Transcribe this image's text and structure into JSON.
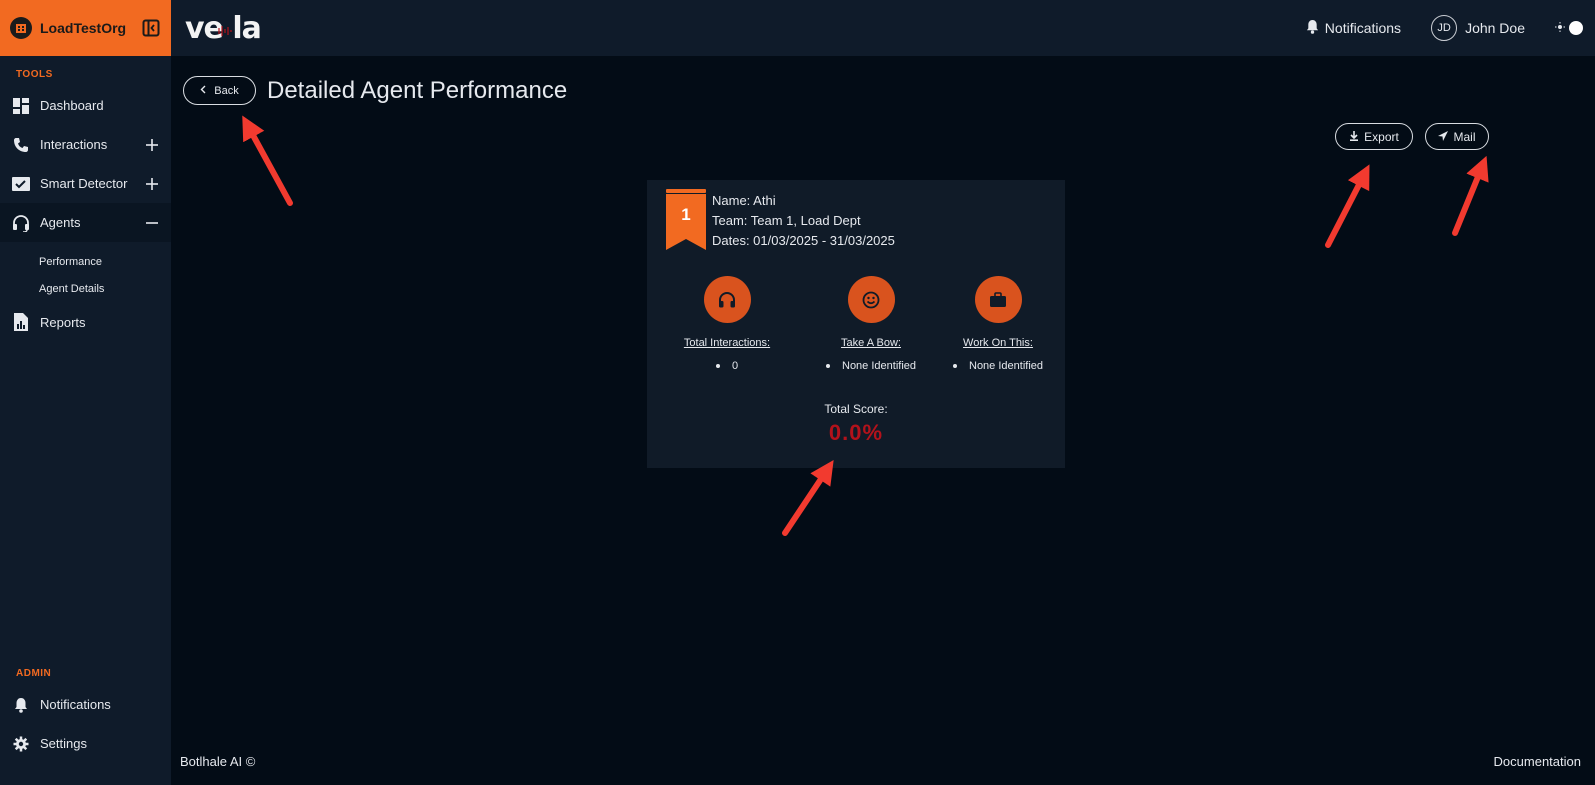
{
  "org": {
    "name": "LoadTestOrg"
  },
  "sidebar": {
    "tools_label": "TOOLS",
    "items": [
      {
        "label": "Dashboard",
        "icon": "dashboard-icon"
      },
      {
        "label": "Interactions",
        "icon": "phone-icon",
        "toggle": "+"
      },
      {
        "label": "Smart Detector",
        "icon": "detector-icon",
        "toggle": "+"
      },
      {
        "label": "Agents",
        "icon": "headset-icon",
        "toggle": "−"
      }
    ],
    "agent_subitems": [
      "Performance",
      "Agent Details"
    ],
    "reports_label": "Reports",
    "admin_label": "ADMIN",
    "admin_items": [
      {
        "label": "Notifications",
        "icon": "bell-icon"
      },
      {
        "label": "Settings",
        "icon": "gear-icon"
      }
    ]
  },
  "topbar": {
    "logo_text": "ve  la",
    "notifications_label": "Notifications",
    "user_initials": "JD",
    "user_name": "John Doe"
  },
  "page": {
    "back_label": "Back",
    "title": "Detailed Agent Performance",
    "export_label": "Export",
    "mail_label": "Mail"
  },
  "agent_card": {
    "rank": "1",
    "name_line": "Name: Athi",
    "team_line": "Team: Team 1, Load Dept",
    "dates_line": "Dates: 01/03/2025 - 31/03/2025",
    "stats": [
      {
        "label": "Total Interactions:",
        "value": "0",
        "icon": "headphones-icon"
      },
      {
        "label": "Take A Bow:",
        "value": "None Identified",
        "icon": "smiley-icon"
      },
      {
        "label": "Work On This:",
        "value": "None Identified",
        "icon": "briefcase-icon"
      }
    ],
    "total_score_label": "Total Score:",
    "total_score_value": "0.0%"
  },
  "footer": {
    "copyright": "Botlhale AI ©",
    "documentation": "Documentation"
  },
  "colors": {
    "accent": "#f26a21",
    "score_red": "#b3121b",
    "annotation_arrow": "#f23a2f"
  }
}
